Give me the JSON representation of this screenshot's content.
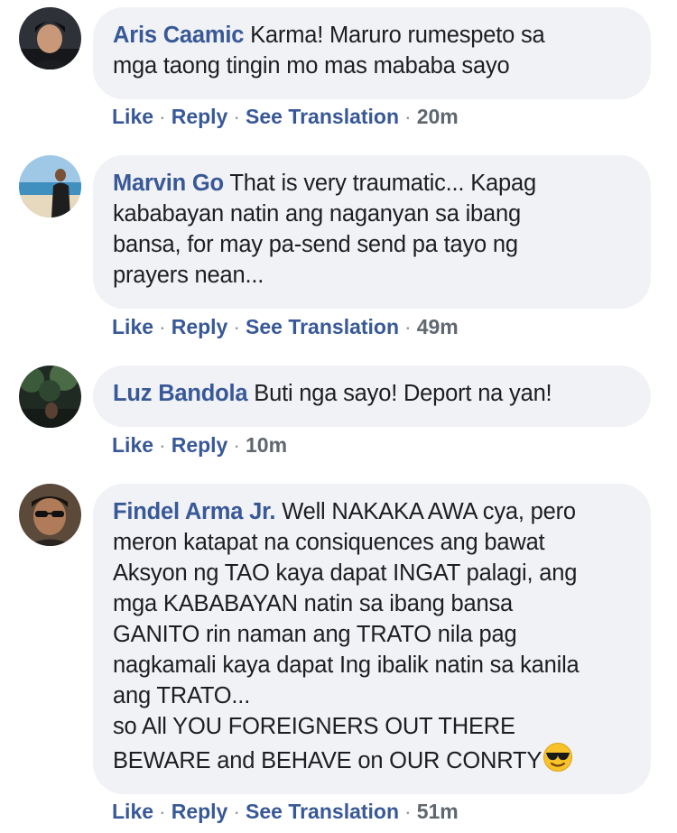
{
  "comments": [
    {
      "author": "Aris Caamic",
      "text": "Karma! Maruro rumespeto sa\nmga taong tingin mo mas mababa sayo",
      "actions": {
        "like": "Like",
        "reply": "Reply",
        "translate": "See Translation",
        "time": "20m"
      }
    },
    {
      "author": "Marvin Go",
      "text": "That is very traumatic... Kapag\nkababayan natin ang naganyan sa ibang\nbansa, for may pa-send send pa tayo ng\nprayers nean...",
      "actions": {
        "like": "Like",
        "reply": "Reply",
        "translate": "See Translation",
        "time": "49m"
      }
    },
    {
      "author": "Luz Bandola",
      "text": "Buti nga sayo! Deport na yan!",
      "actions": {
        "like": "Like",
        "reply": "Reply",
        "time": "10m"
      }
    },
    {
      "author": "Findel Arma Jr.",
      "text": "Well NAKAKA AWA cya, pero\nmeron katapat na consiquences ang bawat\nAksyon ng TAO kaya dapat INGAT palagi, ang\nmga KABABAYAN natin sa ibang bansa\nGANITO rin naman ang TRATO nila pag\nnagkamali kaya dapat Ing ibalik natin sa kanila\nang TRATO...\nso All YOU FOREIGNERS OUT THERE\nBEWARE and BEHAVE on OUR CONRTY",
      "emoji": "sunglasses-emoji",
      "actions": {
        "like": "Like",
        "reply": "Reply",
        "translate": "See Translation",
        "time": "51m"
      }
    }
  ],
  "separator": "·",
  "colors": {
    "author": "#385898",
    "bubble": "#f0f2f5",
    "text": "#1c1e21",
    "time": "#606770"
  }
}
